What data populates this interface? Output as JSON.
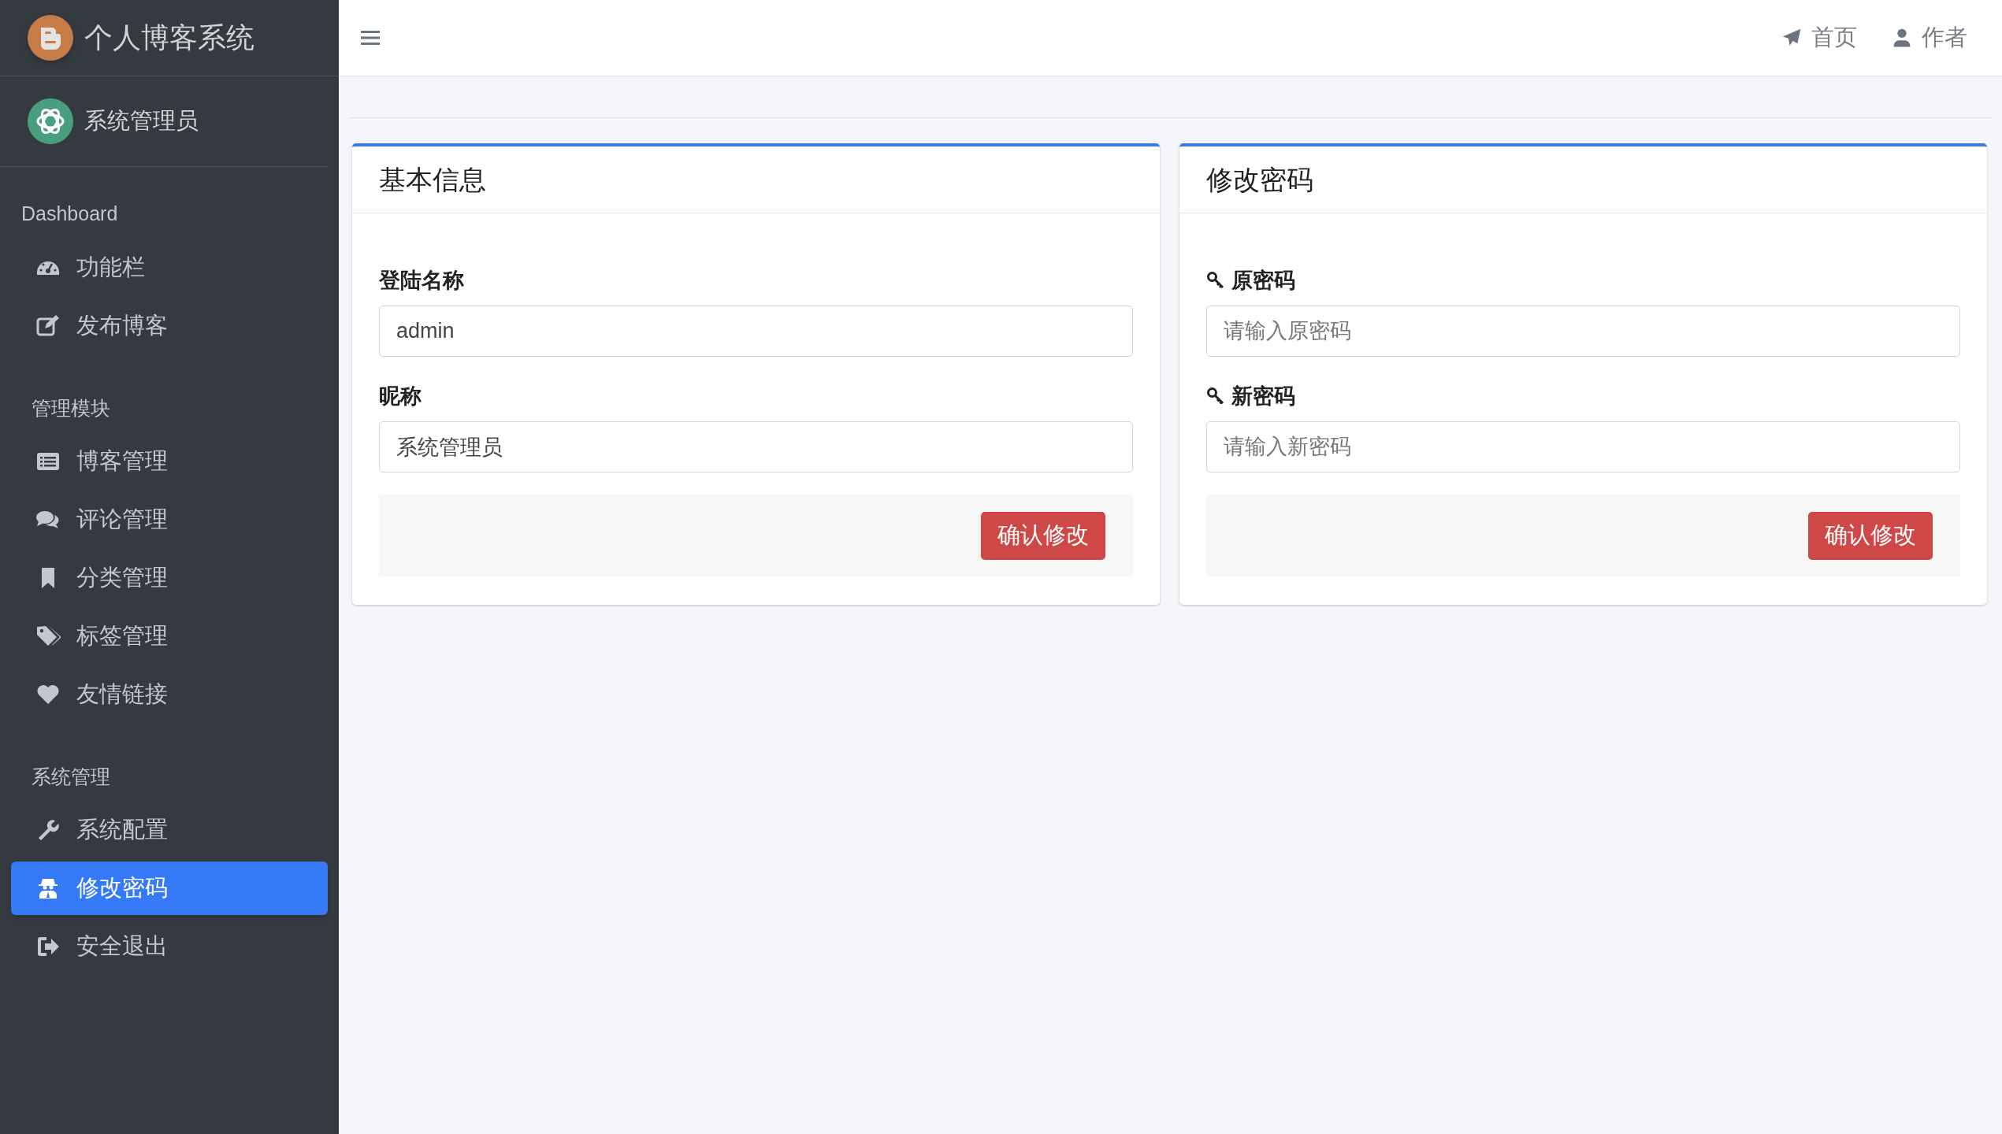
{
  "brand": {
    "title": "个人博客系统"
  },
  "user": {
    "name": "系统管理员"
  },
  "header": {
    "links": [
      {
        "label": "首页"
      },
      {
        "label": "作者"
      }
    ]
  },
  "sidebar": {
    "sections": [
      {
        "heading": "Dashboard",
        "items": [
          {
            "label": "功能栏",
            "selected": false
          },
          {
            "label": "发布博客",
            "selected": false
          }
        ]
      },
      {
        "heading": "管理模块",
        "items": [
          {
            "label": "博客管理",
            "selected": false
          },
          {
            "label": "评论管理",
            "selected": false
          },
          {
            "label": "分类管理",
            "selected": false
          },
          {
            "label": "标签管理",
            "selected": false
          },
          {
            "label": "友情链接",
            "selected": false
          }
        ]
      },
      {
        "heading": "系统管理",
        "items": [
          {
            "label": "系统配置",
            "selected": false
          },
          {
            "label": "修改密码",
            "selected": true
          },
          {
            "label": "安全退出",
            "selected": false
          }
        ]
      }
    ]
  },
  "cards": [
    {
      "title": "基本信息",
      "fields": [
        {
          "kind": "text",
          "label": "登陆名称",
          "value": "admin"
        },
        {
          "kind": "text",
          "label": "昵称",
          "value": "系统管理员"
        }
      ],
      "button": "确认修改"
    },
    {
      "title": "修改密码",
      "fields": [
        {
          "kind": "password",
          "label": "原密码",
          "placeholder": "请输入原密码"
        },
        {
          "kind": "password",
          "label": "新密码",
          "placeholder": "请输入新密码"
        }
      ],
      "button": "确认修改"
    }
  ]
}
